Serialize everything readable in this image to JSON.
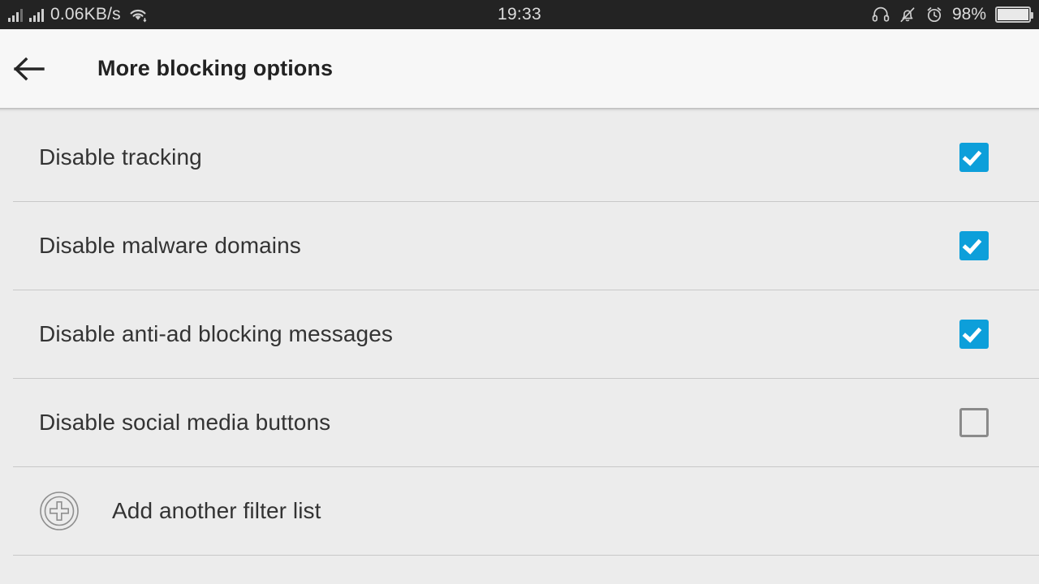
{
  "status_bar": {
    "network_speed": "0.06KB/s",
    "clock": "19:33",
    "battery_percent": "98%",
    "icons": {
      "signal_1": "signal-bars-icon",
      "signal_2": "signal-bars-icon",
      "wifi": "wifi-icon",
      "headset": "headset-icon",
      "bell_muted": "bell-muted-icon",
      "alarm": "alarm-clock-icon",
      "battery": "battery-icon"
    },
    "colors": {
      "background": "#232323",
      "foreground": "#dcdcdc"
    }
  },
  "app_bar": {
    "back_icon": "back-arrow-icon",
    "title": "More blocking options",
    "background": "#f7f7f7"
  },
  "list": {
    "background": "#ececec",
    "accent": "#0d9fda",
    "rows": [
      {
        "label": "Disable tracking",
        "checked": true
      },
      {
        "label": "Disable malware domains",
        "checked": true
      },
      {
        "label": "Disable anti-ad blocking messages",
        "checked": true
      },
      {
        "label": "Disable social media buttons",
        "checked": false
      }
    ],
    "add_row": {
      "icon": "add-circle-icon",
      "label": "Add another filter list"
    }
  }
}
